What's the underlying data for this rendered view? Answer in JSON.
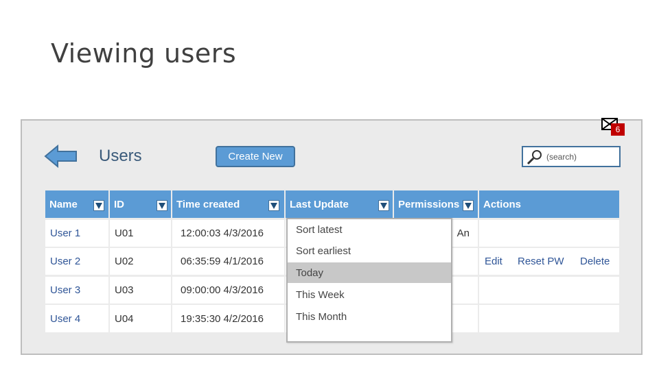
{
  "slide_title": "Viewing users",
  "notifications": {
    "count": "6",
    "icon": "mail-icon"
  },
  "header": {
    "title": "Users",
    "create_label": "Create New",
    "search_placeholder": "(search)"
  },
  "table": {
    "columns": [
      "Name",
      "ID",
      "Time created",
      "Last Update",
      "Permissions",
      "Actions"
    ],
    "rows": [
      {
        "name": "User 1",
        "id": "U01",
        "created": "12:00:03 4/3/2016",
        "permissions": "An"
      },
      {
        "name": "User 2",
        "id": "U02",
        "created": "06:35:59 4/1/2016",
        "actions": [
          "Edit",
          "Reset PW",
          "Delete"
        ]
      },
      {
        "name": "User 3",
        "id": "U03",
        "created": "09:00:00 4/3/2016"
      },
      {
        "name": "User 4",
        "id": "U04",
        "created": "19:35:30 4/2/2016"
      }
    ]
  },
  "dropdown": {
    "items": [
      "Sort latest",
      "Sort earliest",
      "Today",
      "This Week",
      "This Month"
    ],
    "selected": "Today"
  },
  "colors": {
    "header_blue": "#5b9bd5",
    "border_blue": "#41719c",
    "badge_red": "#c00000",
    "highlight_gray": "#c8c8c8"
  }
}
